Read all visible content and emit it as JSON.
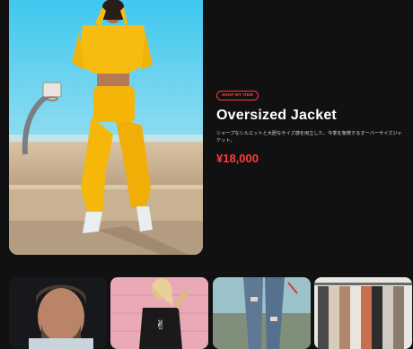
{
  "product": {
    "badge": "SHOP MY ITEM",
    "title": "Oversized Jacket",
    "description": "シャープなシルエットと大胆なサイズ感を両立した、今季を象徴するオーバーサイズジャケット。",
    "price": "¥18,000"
  },
  "colors": {
    "background": "#111112",
    "accent": "#ff3b3b",
    "outfit": "#f4b90b"
  },
  "thumbnails": [
    {
      "name": "thumbnail-bearded-man"
    },
    {
      "name": "thumbnail-woman-pink-wall"
    },
    {
      "name": "thumbnail-ripped-jeans"
    },
    {
      "name": "thumbnail-clothes-rack"
    }
  ]
}
